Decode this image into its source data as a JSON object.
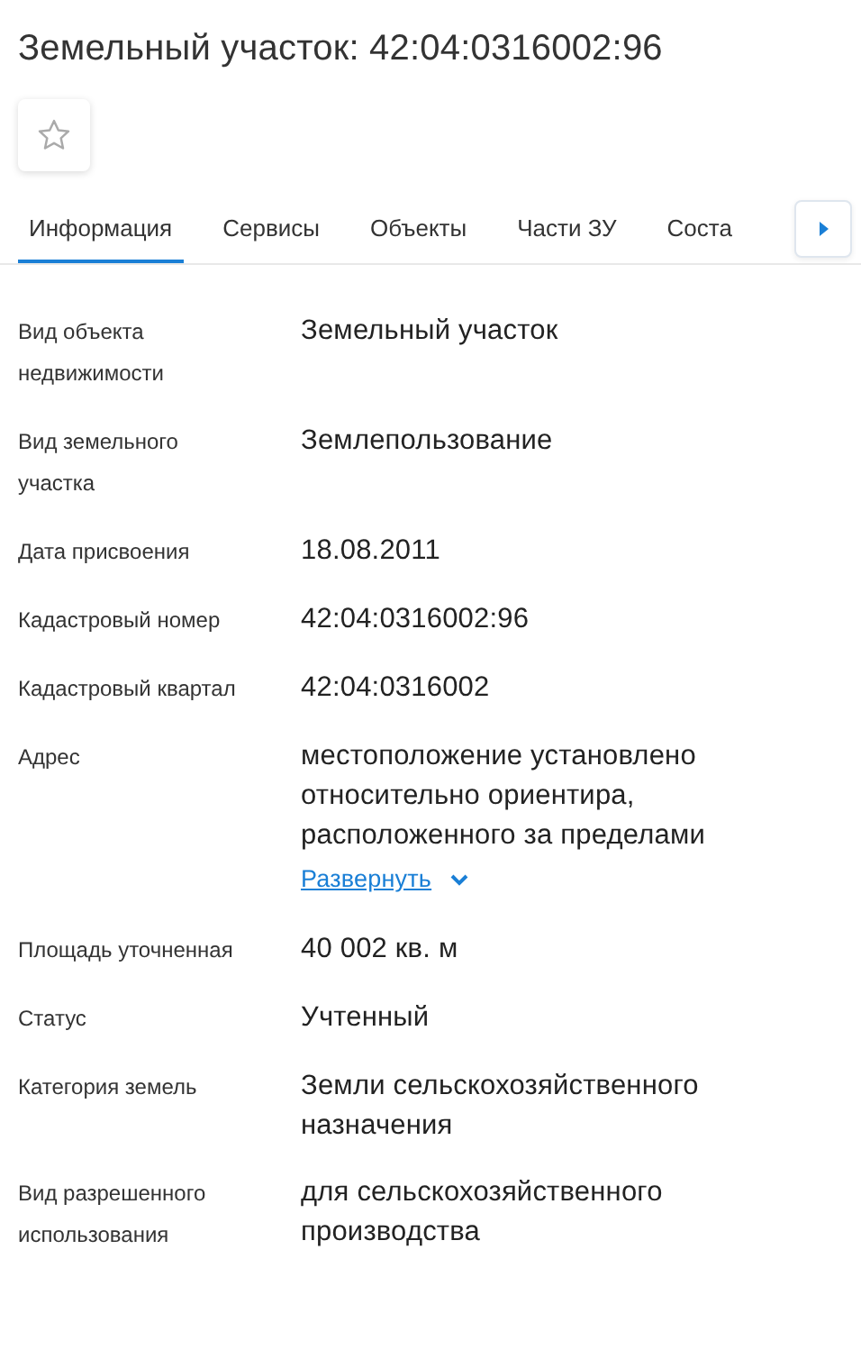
{
  "title": "Земельный участок: 42:04:0316002:96",
  "favorite": {
    "on": false
  },
  "tabs": [
    {
      "label": "Информация",
      "selected": true
    },
    {
      "label": "Сервисы",
      "selected": false
    },
    {
      "label": "Объекты",
      "selected": false
    },
    {
      "label": "Части ЗУ",
      "selected": false
    },
    {
      "label": "Соста",
      "selected": false
    }
  ],
  "fields": [
    {
      "label": "Вид объекта недвижимости",
      "value": "Земельный участок"
    },
    {
      "label": "Вид земельного участка",
      "value": "Землепользование"
    },
    {
      "label": "Дата присвоения",
      "value": "18.08.2011"
    },
    {
      "label": "Кадастровый номер",
      "value": "42:04:0316002:96"
    },
    {
      "label": "Кадастровый квартал",
      "value": "42:04:0316002"
    },
    {
      "label": "Адрес",
      "value": "местоположение установлено относительно ориентира, расположенного за пределами",
      "expand_link": "Развернуть"
    },
    {
      "label": "Площадь уточненная",
      "value": "40 002 кв. м"
    },
    {
      "label": "Статус",
      "value": "Учтенный"
    },
    {
      "label": "Категория земель",
      "value": "Земли сельскохозяйственного назначения"
    },
    {
      "label": "Вид разрешенного использования",
      "value": "для сельскохозяйственного производства"
    }
  ]
}
